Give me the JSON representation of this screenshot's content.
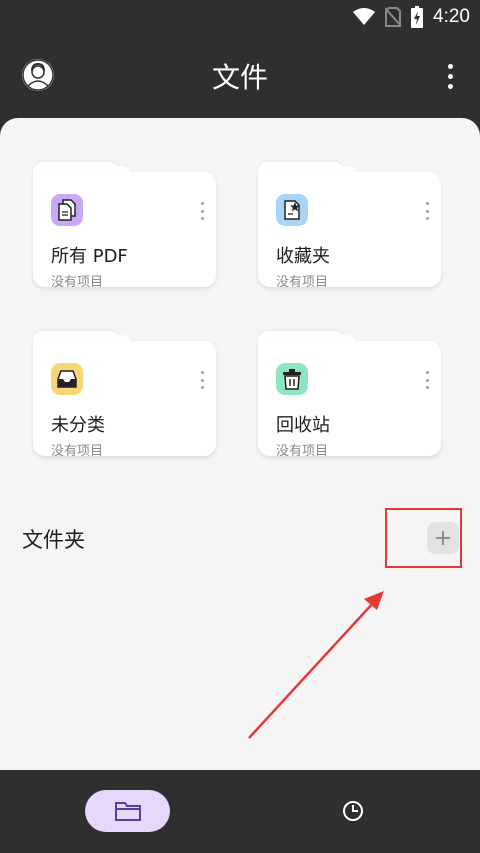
{
  "status_bar": {
    "time": "4:20"
  },
  "app_bar": {
    "title": "文件"
  },
  "cards": [
    {
      "title": "所有 PDF",
      "subtitle": "没有项目",
      "icon": "pdf-file-icon",
      "color": "#c9a9f5"
    },
    {
      "title": "收藏夹",
      "subtitle": "没有项目",
      "icon": "starred-file-icon",
      "color": "#a9d4f5"
    },
    {
      "title": "未分类",
      "subtitle": "没有项目",
      "icon": "inbox-icon",
      "color": "#f7d774"
    },
    {
      "title": "回收站",
      "subtitle": "没有项目",
      "icon": "trash-icon",
      "color": "#8ee6c0"
    }
  ],
  "folders": {
    "title": "文件夹",
    "add_icon": "plus-icon"
  },
  "bottom_nav": {
    "items": [
      {
        "icon": "folder-icon",
        "selected": true
      },
      {
        "icon": "recent-icon",
        "selected": false
      }
    ]
  },
  "colors": {
    "accent": "#e6d8fb",
    "highlight": "#e53935",
    "background": "#2f2f2f",
    "sheet": "#f5f5f5"
  }
}
